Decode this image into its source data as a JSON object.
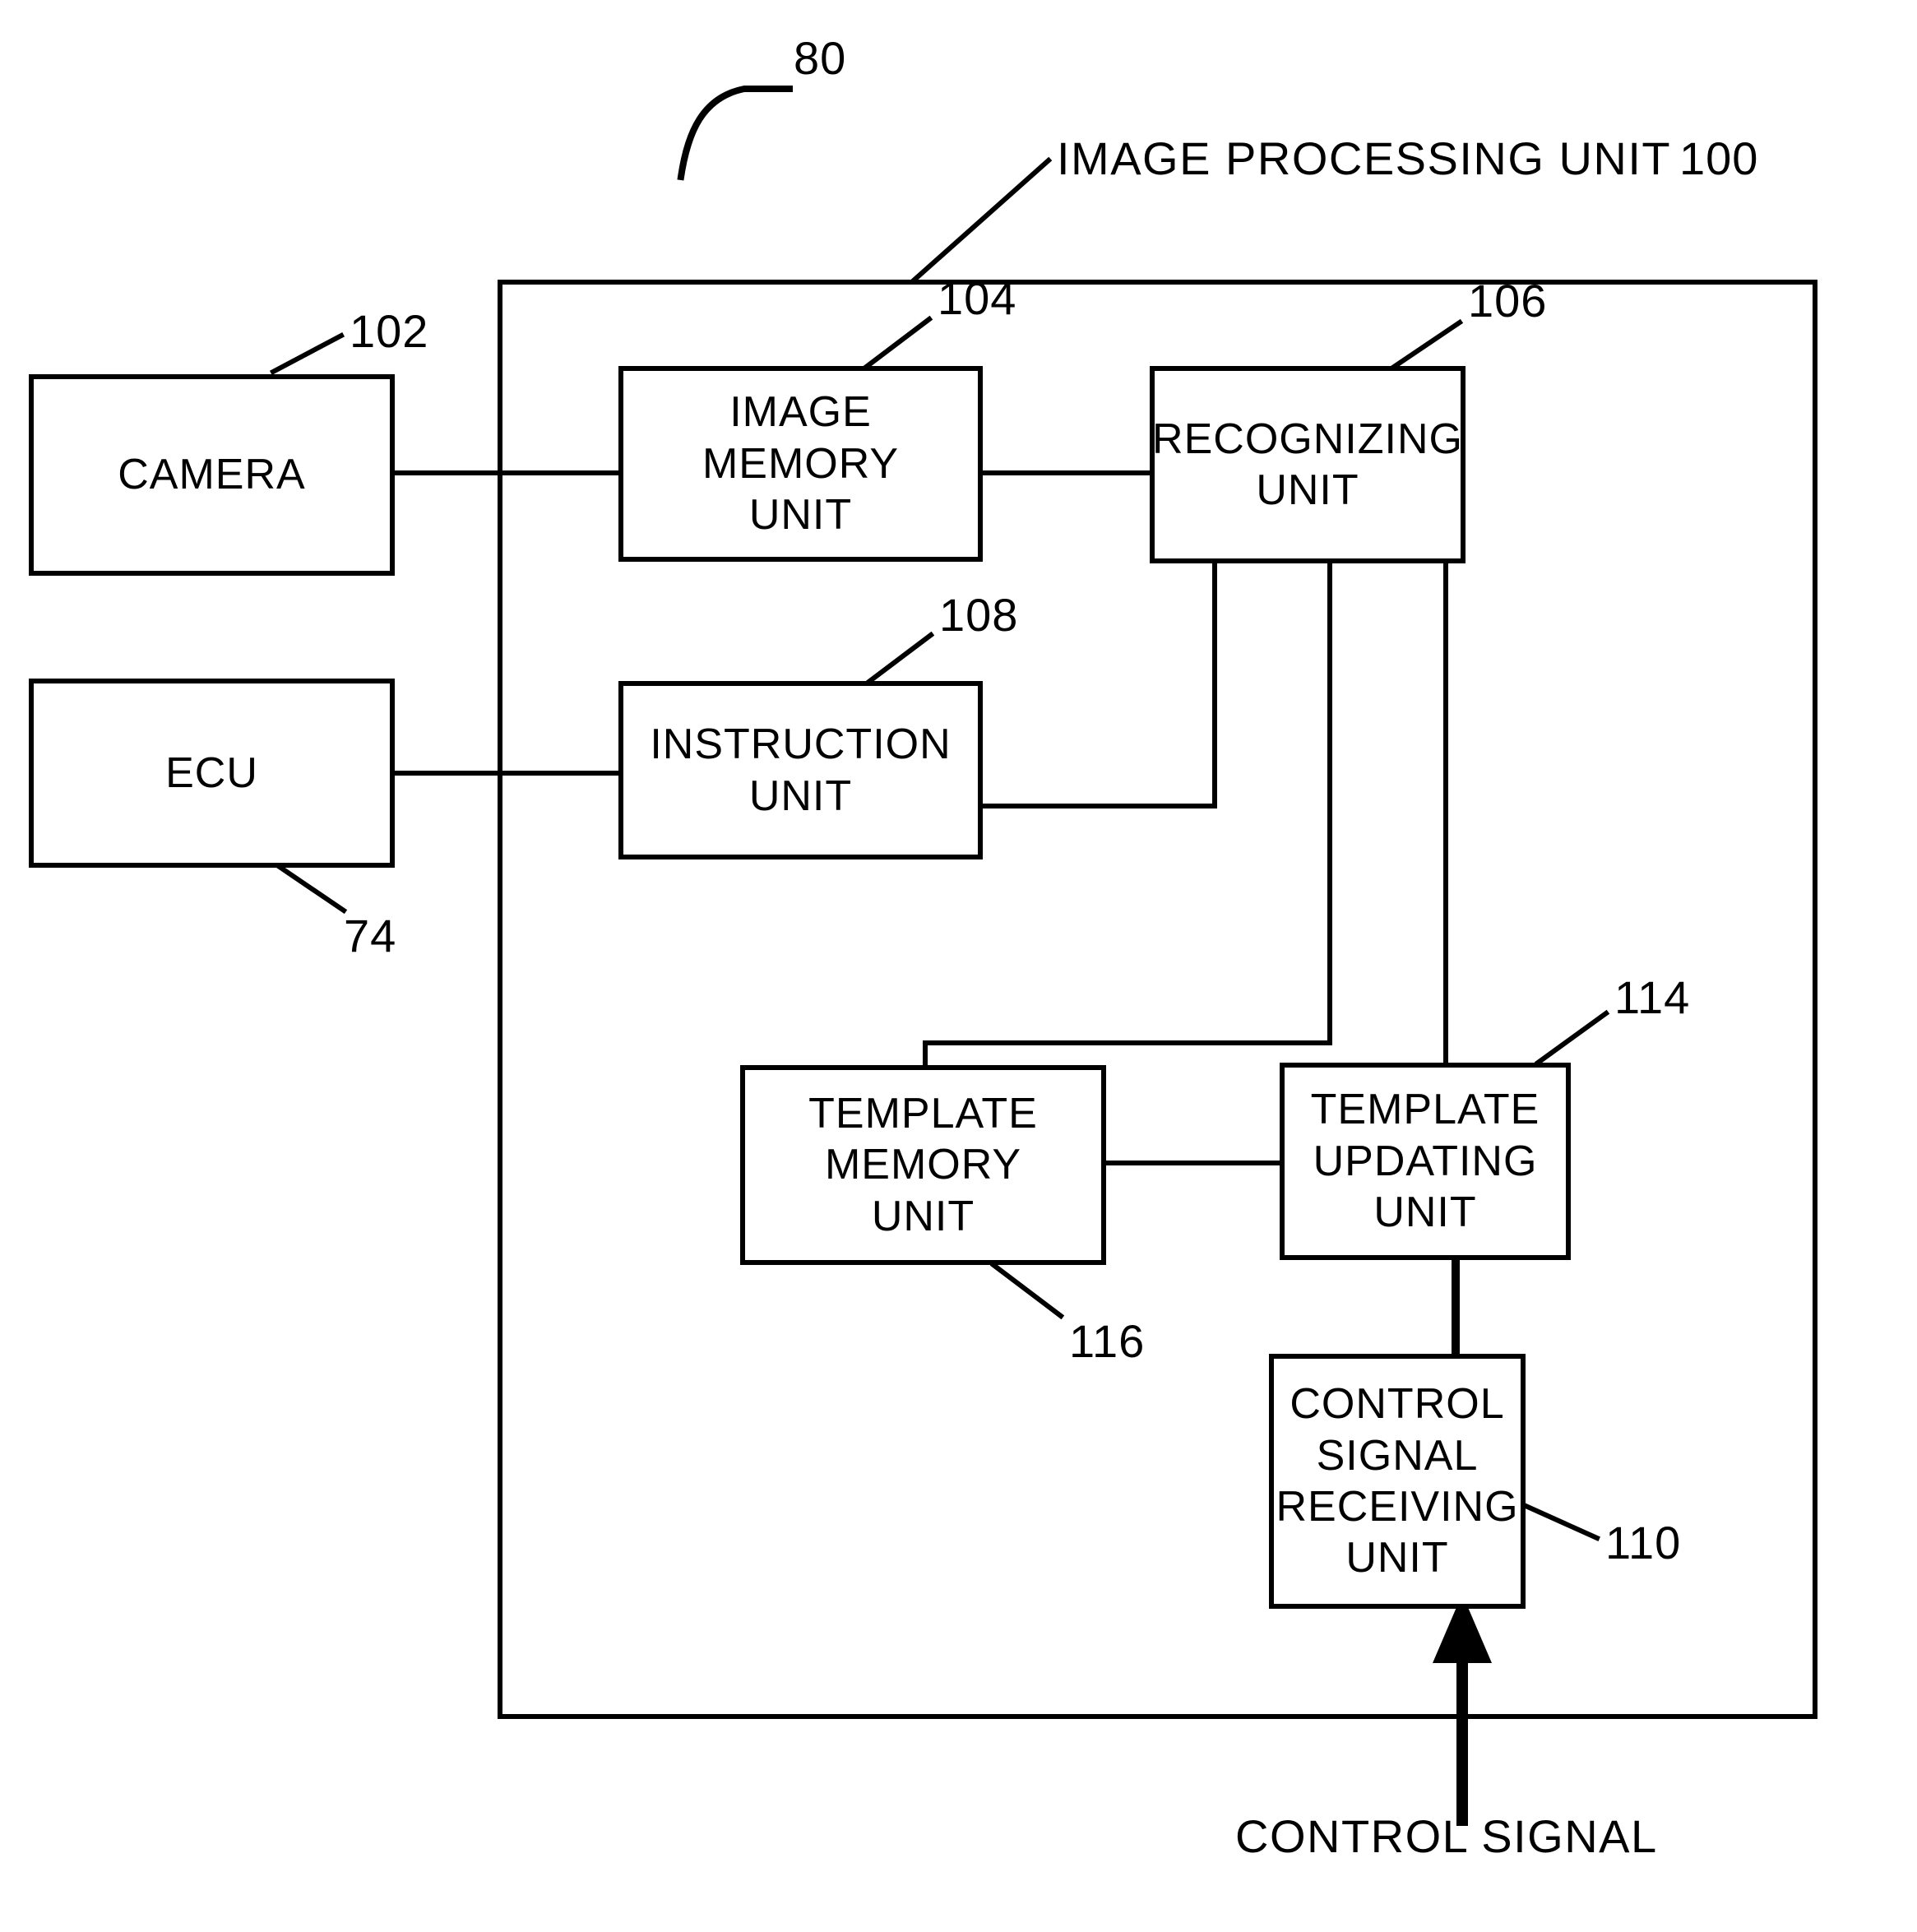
{
  "figure": {
    "system_ref": "80",
    "container": {
      "title": "IMAGE PROCESSING UNIT",
      "ref": "100"
    }
  },
  "blocks": [
    {
      "id": "camera",
      "label": "CAMERA",
      "ref": "102"
    },
    {
      "id": "ecu",
      "label": "ECU",
      "ref": "74"
    },
    {
      "id": "image_mem",
      "label": "IMAGE\nMEMORY\nUNIT",
      "ref": "104"
    },
    {
      "id": "recognize",
      "label": "RECOGNIZING\nUNIT",
      "ref": "106"
    },
    {
      "id": "instruct",
      "label": "INSTRUCTION\nUNIT",
      "ref": "108"
    },
    {
      "id": "tpl_mem",
      "label": "TEMPLATE\nMEMORY\nUNIT",
      "ref": "116"
    },
    {
      "id": "tpl_upd",
      "label": "TEMPLATE\nUPDATING\nUNIT",
      "ref": "114"
    },
    {
      "id": "ctrl_recv",
      "label": "CONTROL\nSIGNAL\nRECEIVING\nUNIT",
      "ref": "110"
    }
  ],
  "signals": {
    "control_signal": "CONTROL SIGNAL"
  },
  "colors": {
    "line": "#000000",
    "background": "#ffffff"
  }
}
